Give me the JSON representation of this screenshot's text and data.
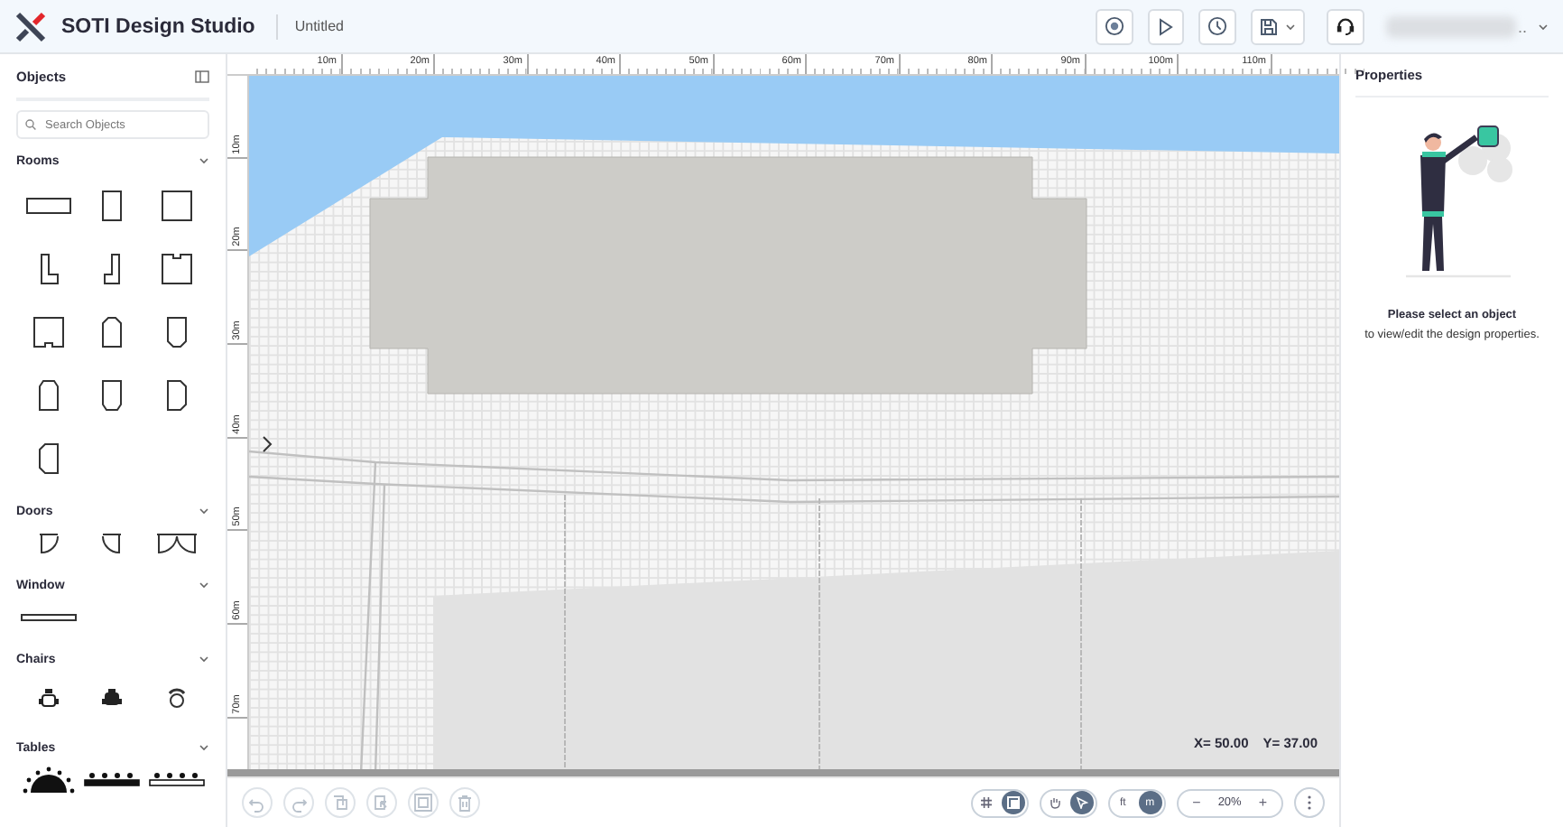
{
  "header": {
    "app_name": "SOTI Design Studio",
    "document_title": "Untitled",
    "actions": [
      {
        "kind": "target"
      },
      {
        "kind": "play"
      },
      {
        "kind": "clock"
      },
      {
        "kind": "save"
      },
      {
        "kind": "headset"
      }
    ],
    "user": {
      "name": ".."
    }
  },
  "left_panel": {
    "title": "Objects",
    "search": {
      "placeholder": "Search Objects"
    },
    "sections": [
      {
        "title": "Rooms",
        "expanded": true,
        "items": [
          {
            "kind": "room-wide"
          },
          {
            "kind": "room-tall"
          },
          {
            "kind": "room-square"
          },
          {
            "kind": "room-l"
          },
          {
            "kind": "room-j"
          },
          {
            "kind": "room-notch-top"
          },
          {
            "kind": "room-notch-bottom"
          },
          {
            "kind": "room-arch"
          },
          {
            "kind": "room-point-bottom"
          },
          {
            "kind": "room-cut-top"
          },
          {
            "kind": "room-cut-bottom"
          },
          {
            "kind": "room-cut-right"
          },
          {
            "kind": "room-cut-left"
          }
        ]
      },
      {
        "title": "Doors",
        "expanded": true,
        "items": [
          {
            "kind": "door-left"
          },
          {
            "kind": "door-right"
          },
          {
            "kind": "door-double"
          }
        ]
      },
      {
        "title": "Window",
        "expanded": true,
        "items": [
          {
            "kind": "window"
          }
        ]
      },
      {
        "title": "Chairs",
        "expanded": true,
        "items": [
          {
            "kind": "chair-office"
          },
          {
            "kind": "chair-arm"
          },
          {
            "kind": "chair-round"
          }
        ]
      },
      {
        "title": "Tables",
        "expanded": true,
        "items": [
          {
            "kind": "table-round"
          },
          {
            "kind": "table-long"
          },
          {
            "kind": "table-row"
          }
        ]
      }
    ]
  },
  "canvas": {
    "ruler_x": [
      "10m",
      "20m",
      "30m",
      "40m",
      "50m",
      "60m",
      "70m",
      "80m",
      "90m",
      "100m",
      "110m"
    ],
    "ruler_y": [
      "10m",
      "20m",
      "30m",
      "40m",
      "50m",
      "60m",
      "70m"
    ],
    "coordinates": {
      "x": "X= 50.00",
      "y": "Y= 37.00"
    }
  },
  "properties": {
    "title": "Properties",
    "empty_title": "Please select an object",
    "empty_text": "to view/edit the design properties."
  },
  "toolbar": {
    "edit_actions": [
      {
        "kind": "undo",
        "disabled": true
      },
      {
        "kind": "redo",
        "disabled": true
      },
      {
        "kind": "copy",
        "disabled": true
      },
      {
        "kind": "paste",
        "disabled": true
      },
      {
        "kind": "select-all",
        "disabled": true
      },
      {
        "kind": "delete",
        "disabled": true
      }
    ],
    "toggles": [
      {
        "options": [
          {
            "kind": "grid",
            "selected": false
          },
          {
            "kind": "snap",
            "selected": true
          }
        ]
      },
      {
        "options": [
          {
            "kind": "pan",
            "selected": false
          },
          {
            "kind": "pointer",
            "selected": true
          }
        ]
      }
    ],
    "units": [
      {
        "label": "ft",
        "selected": false
      },
      {
        "label": "m",
        "selected": true
      }
    ],
    "zoom": {
      "minus": "−",
      "value": "20%",
      "plus": "+"
    }
  }
}
